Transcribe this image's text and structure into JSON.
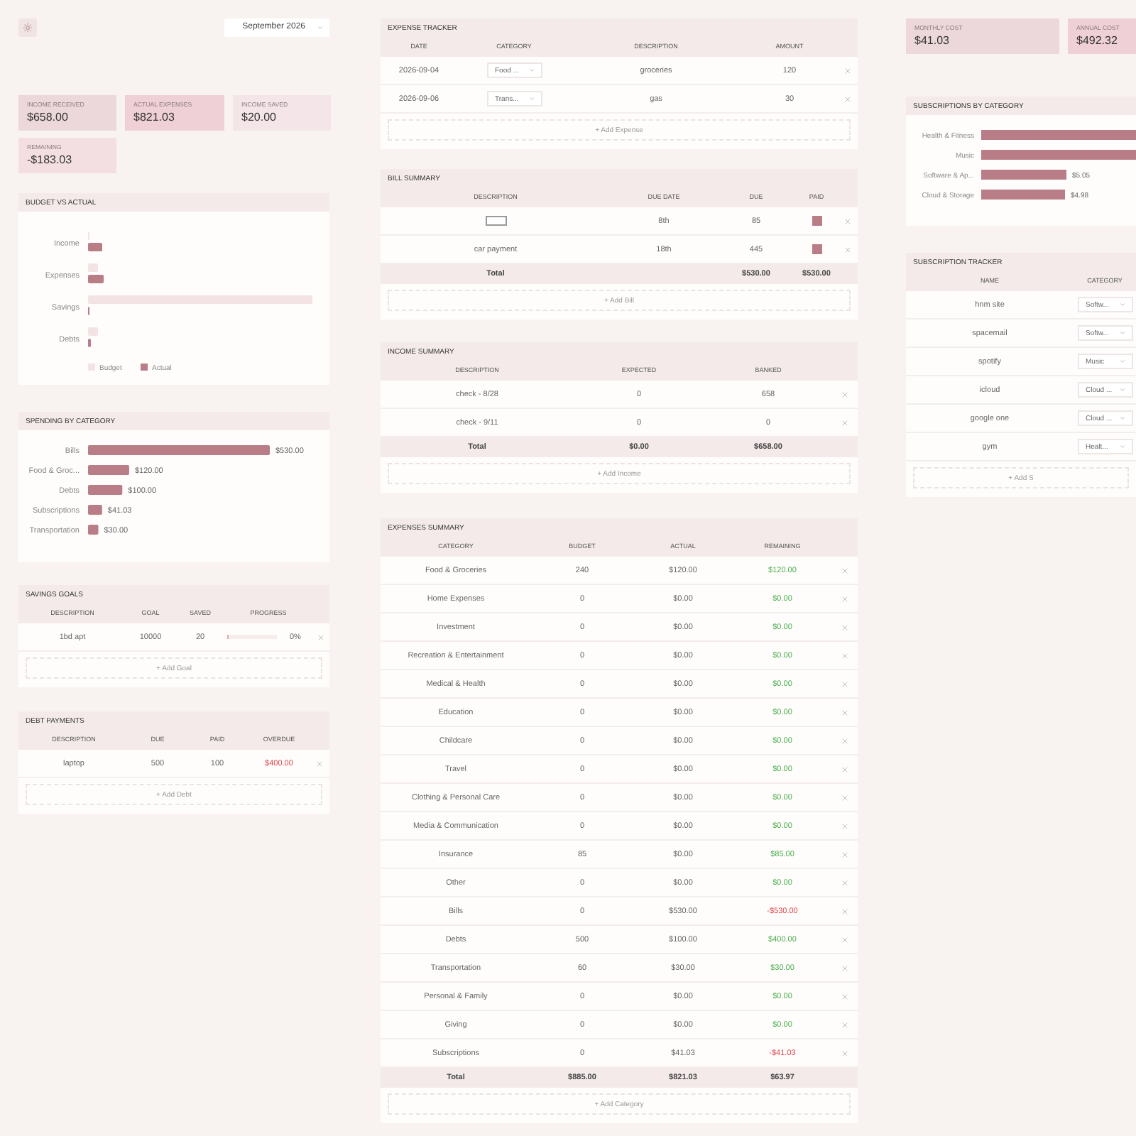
{
  "toolbar": {
    "month": "September 2026"
  },
  "stats": [
    {
      "label": "INCOME RECEIVED",
      "value": "$658.00",
      "color": "#ecd8da"
    },
    {
      "label": "ACTUAL EXPENSES",
      "value": "$821.03",
      "color": "#efd0d6"
    },
    {
      "label": "INCOME SAVED",
      "value": "$20.00",
      "color": "#f4e6e8"
    },
    {
      "label": "REMAINING",
      "value": "-$183.03",
      "color": "#f3dfe2"
    }
  ],
  "budget_vs_actual": {
    "title": "BUDGET VS ACTUAL",
    "categories": [
      "Income",
      "Expenses",
      "Savings",
      "Debts"
    ],
    "legend": [
      {
        "label": "Budget",
        "color": "#f3e3e5"
      },
      {
        "label": "Actual",
        "color": "#b87d86"
      }
    ]
  },
  "spending_by_category": {
    "title": "SPENDING BY CATEGORY",
    "chart_data": {
      "type": "bar",
      "orientation": "horizontal",
      "categories": [
        "Bills",
        "Food & Groc...",
        "Debts",
        "Subscriptions",
        "Transportation"
      ],
      "values": [
        530,
        120,
        100,
        41.03,
        30
      ],
      "value_labels": [
        "$530.00",
        "$120.00",
        "$100.00",
        "$41.03",
        "$30.00"
      ]
    }
  },
  "savings_goals": {
    "title": "SAVINGS GOALS",
    "columns": [
      "DESCRIPTION",
      "GOAL",
      "SAVED",
      "PROGRESS"
    ],
    "rows": [
      {
        "description": "1bd apt",
        "goal": "10000",
        "saved": "20",
        "level": 0.002,
        "percent": "0%"
      }
    ],
    "add": "+ Add Goal"
  },
  "debt_payments": {
    "title": "DEBT PAYMENTS",
    "columns": [
      "DESCRIPTION",
      "DUE",
      "PAID",
      "OVERDUE"
    ],
    "rows": [
      {
        "description": "laptop",
        "due": "500",
        "paid": "100",
        "overdue": "$400.00",
        "color": "#e0474c"
      }
    ],
    "add": "+ Add Debt"
  },
  "expense_tracker": {
    "title": "EXPENSE TRACKER",
    "columns": [
      "DATE",
      "CATEGORY",
      "DESCRIPTION",
      "AMOUNT"
    ],
    "rows": [
      {
        "date": "2026-09-04",
        "category": "Food ...",
        "description": "groceries",
        "amount": "120"
      },
      {
        "date": "2026-09-06",
        "category": "Trans...",
        "description": "gas",
        "amount": "30"
      }
    ],
    "add": "+ Add Expense"
  },
  "bill_summary": {
    "title": "BILL SUMMARY",
    "columns": [
      "DESCRIPTION",
      "DUE DATE",
      "DUE",
      "PAID"
    ],
    "rows": [
      {
        "kind": "input",
        "due_date": "8th",
        "due": "85",
        "paid": true
      },
      {
        "kind": "text",
        "description": "car payment",
        "due_date": "18th",
        "due": "445",
        "paid": true
      }
    ],
    "total": {
      "label": "Total",
      "due": "$530.00",
      "paid": "$530.00"
    },
    "add": "+ Add Bill"
  },
  "income_summary": {
    "title": "INCOME SUMMARY",
    "columns": [
      "DESCRIPTION",
      "EXPECTED",
      "BANKED"
    ],
    "rows": [
      {
        "description": "check - 8/28",
        "expected": "0",
        "banked": "658"
      },
      {
        "description": "check - 9/11",
        "expected": "0",
        "banked": "0"
      }
    ],
    "total": {
      "label": "Total",
      "expected": "$0.00",
      "banked": "$658.00"
    },
    "add": "+ Add Income"
  },
  "expenses_summary": {
    "title": "EXPENSES SUMMARY",
    "columns": [
      "CATEGORY",
      "BUDGET",
      "ACTUAL",
      "REMAINING"
    ],
    "rows": [
      {
        "category": "Food & Groceries",
        "budget": "240",
        "actual": "$120.00",
        "remaining": "$120.00",
        "color": "#4caf50"
      },
      {
        "category": "Home Expenses",
        "budget": "0",
        "actual": "$0.00",
        "remaining": "$0.00",
        "color": "#4caf50"
      },
      {
        "category": "Investment",
        "budget": "0",
        "actual": "$0.00",
        "remaining": "$0.00",
        "color": "#4caf50"
      },
      {
        "category": "Recreation & Entertainment",
        "budget": "0",
        "actual": "$0.00",
        "remaining": "$0.00",
        "color": "#4caf50"
      },
      {
        "category": "Medical & Health",
        "budget": "0",
        "actual": "$0.00",
        "remaining": "$0.00",
        "color": "#4caf50"
      },
      {
        "category": "Education",
        "budget": "0",
        "actual": "$0.00",
        "remaining": "$0.00",
        "color": "#4caf50"
      },
      {
        "category": "Childcare",
        "budget": "0",
        "actual": "$0.00",
        "remaining": "$0.00",
        "color": "#4caf50"
      },
      {
        "category": "Travel",
        "budget": "0",
        "actual": "$0.00",
        "remaining": "$0.00",
        "color": "#4caf50"
      },
      {
        "category": "Clothing & Personal Care",
        "budget": "0",
        "actual": "$0.00",
        "remaining": "$0.00",
        "color": "#4caf50"
      },
      {
        "category": "Media & Communication",
        "budget": "0",
        "actual": "$0.00",
        "remaining": "$0.00",
        "color": "#4caf50"
      },
      {
        "category": "Insurance",
        "budget": "85",
        "actual": "$0.00",
        "remaining": "$85.00",
        "color": "#4caf50"
      },
      {
        "category": "Other",
        "budget": "0",
        "actual": "$0.00",
        "remaining": "$0.00",
        "color": "#4caf50"
      },
      {
        "category": "Bills",
        "budget": "0",
        "actual": "$530.00",
        "remaining": "-$530.00",
        "color": "#e0474c"
      },
      {
        "category": "Debts",
        "budget": "500",
        "actual": "$100.00",
        "remaining": "$400.00",
        "color": "#4caf50"
      },
      {
        "category": "Transportation",
        "budget": "60",
        "actual": "$30.00",
        "remaining": "$30.00",
        "color": "#4caf50"
      },
      {
        "category": "Personal & Family",
        "budget": "0",
        "actual": "$0.00",
        "remaining": "$0.00",
        "color": "#4caf50"
      },
      {
        "category": "Giving",
        "budget": "0",
        "actual": "$0.00",
        "remaining": "$0.00",
        "color": "#4caf50"
      },
      {
        "category": "Subscriptions",
        "budget": "0",
        "actual": "$41.03",
        "remaining": "-$41.03",
        "color": "#e0474c"
      }
    ],
    "total": {
      "label": "Total",
      "budget": "$885.00",
      "actual": "$821.03",
      "remaining": "$63.97"
    },
    "add": "+ Add Category"
  },
  "subscription_stats": [
    {
      "label": "MONTHLY COST",
      "value": "$41.03",
      "color": "#ecd8da"
    },
    {
      "label": "ANNUAL COST",
      "value": "$492.32",
      "color": "#efd0d6"
    }
  ],
  "subscriptions_by_category": {
    "title": "SUBSCRIPTIONS BY CATEGORY",
    "items": [
      {
        "label": "Health & Fitness"
      },
      {
        "label": "Music"
      },
      {
        "label": "Software & Ap...",
        "amount": "$5.05"
      },
      {
        "label": "Cloud & Storage",
        "amount": "$4.98"
      }
    ]
  },
  "subscription_tracker": {
    "title": "SUBSCRIPTION TRACKER",
    "columns": [
      "NAME",
      "CATEGORY"
    ],
    "rows": [
      {
        "name": "hnm site",
        "category": "Softw..."
      },
      {
        "name": "spacemail",
        "category": "Softw..."
      },
      {
        "name": "spotify",
        "category": "Music"
      },
      {
        "name": "icloud",
        "category": "Cloud ..."
      },
      {
        "name": "google one",
        "category": "Cloud ..."
      },
      {
        "name": "gym",
        "category": "Healt..."
      }
    ],
    "add": "+ Add S"
  }
}
